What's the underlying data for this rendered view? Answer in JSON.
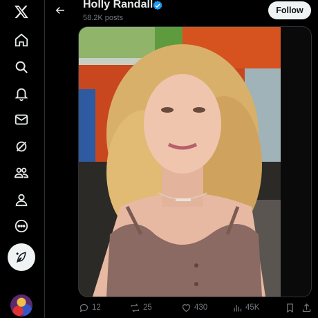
{
  "sidebar": {
    "items": [
      {
        "icon": "x-logo-icon"
      },
      {
        "icon": "home-icon"
      },
      {
        "icon": "search-icon"
      },
      {
        "icon": "bell-icon"
      },
      {
        "icon": "mail-icon"
      },
      {
        "icon": "grok-icon"
      },
      {
        "icon": "communities-icon"
      },
      {
        "icon": "profile-icon"
      },
      {
        "icon": "more-icon"
      }
    ],
    "compose_icon": "compose-post-icon"
  },
  "header": {
    "name": "Holly Randall",
    "post_count": "58.2K posts",
    "follow_label": "Follow"
  },
  "actions": {
    "replies": "12",
    "reposts": "25",
    "likes": "430",
    "views": "45K"
  },
  "colors": {
    "background": "#000000",
    "text": "#e7e9ea",
    "muted": "#71767b",
    "verified": "#1d9bf0",
    "follow_bg": "#eff3f4"
  }
}
